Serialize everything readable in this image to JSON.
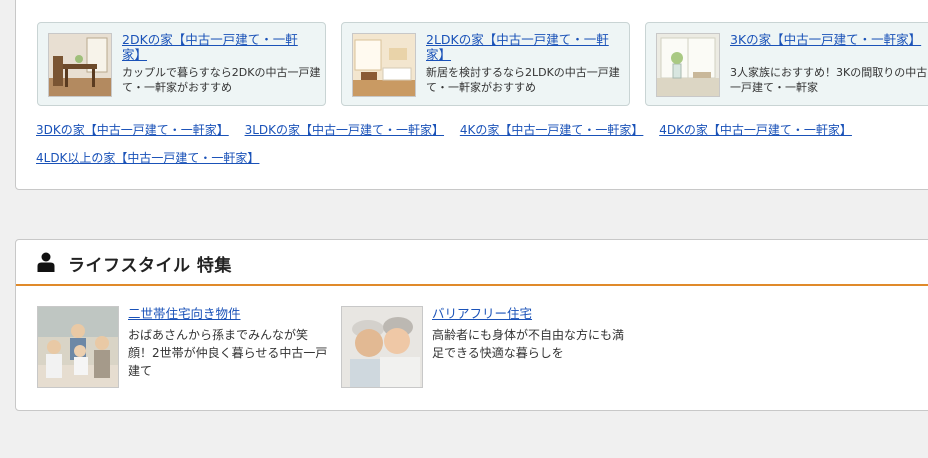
{
  "home_type_cards": [
    {
      "title": "2DKの家【中古一戸建て・一軒家】",
      "description": "カップルで暮らすなら2DKの中古一戸建て・一軒家がおすすめ",
      "image": "dining-room-photo"
    },
    {
      "title": "2LDKの家【中古一戸建て・一軒家】",
      "description": "新居を検討するなら2LDKの中古一戸建て・一軒家がおすすめ",
      "image": "living-room-photo"
    },
    {
      "title": "3Kの家【中古一戸建て・一軒家】",
      "description": "3人家族におすすめ！3Kの間取りの中古一戸建て・一軒家",
      "image": "window-vase-photo"
    }
  ],
  "home_type_links": [
    "3DKの家【中古一戸建て・一軒家】",
    "3LDKの家【中古一戸建て・一軒家】",
    "4Kの家【中古一戸建て・一軒家】",
    "4DKの家【中古一戸建て・一軒家】",
    "4LDK以上の家【中古一戸建て・一軒家】"
  ],
  "lifestyle": {
    "heading": "ライフスタイル 特集",
    "heading_icon": "person-icon",
    "accent_color": "#e08a2a",
    "items": [
      {
        "title": "二世帯住宅向き物件",
        "description": "おばあさんから孫までみんなが笑顔！2世帯が仲良く暮らせる中古一戸建て",
        "image": "family-photo"
      },
      {
        "title": "バリアフリー住宅",
        "description": "高齢者にも身体が不自由な方にも満足できる快適な暮らしを",
        "image": "elderly-couple-photo"
      }
    ]
  }
}
